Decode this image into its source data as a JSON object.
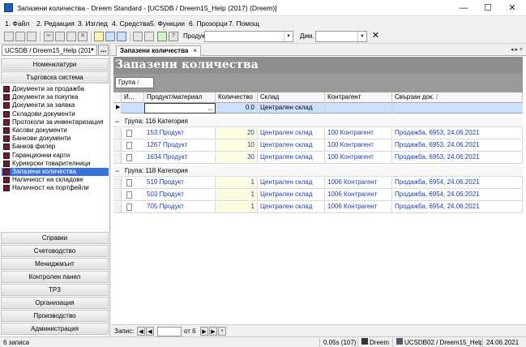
{
  "window": {
    "title": "Запазени количества - Dreem Standard - [UCSDB / Dreem15_Help (2017) (Dreem)]"
  },
  "menu": [
    "1. Файл",
    "2. Редакция",
    "3. Изглед",
    "4. Средства",
    "5. Функции",
    "6. Прозорци",
    "7. Помощ"
  ],
  "toolbar": {
    "product_label": "Продукт:",
    "dim_label": "Дим."
  },
  "sidebar": {
    "db": "UCSDB / Dreem15_Help (201",
    "top_sections": [
      "Номенклатури",
      "Търговска система"
    ],
    "items": [
      "Документи за продажба",
      "Документи за покупка",
      "Документи за заявка",
      "Складови документи",
      "Протоколи за инвентаризация",
      "Касови документи",
      "Банкови документи",
      "Банков филер",
      "Гаранционни карти",
      "Куриерски товарителници",
      "Запазени количества",
      "Наличност на складове",
      "Наличност на портфейли"
    ],
    "selected": "Запазени количества",
    "bottom_sections": [
      "Справки",
      "Счетоводство",
      "Мениджмънт",
      "Контролен панел",
      "ТРЗ",
      "Организация",
      "Производство",
      "Администрация"
    ]
  },
  "tab": {
    "label": "Запазени количества",
    "close": "×",
    "controls": "◂ ▸ ×"
  },
  "header": {
    "title": "Запазени количества"
  },
  "group_chip": "Група",
  "grid": {
    "columns": [
      "И...",
      "Продукт/материал",
      "Количество",
      "Склад",
      "Контрагент",
      "Свързан док."
    ],
    "new_row": {
      "qty": "0.0",
      "warehouse": "Централен склад"
    },
    "groups": [
      {
        "label": "Група: 116 Категория",
        "rows": [
          {
            "product": "153 Продукт",
            "qty": "20",
            "warehouse": "Централен склад",
            "partner": "100 Контрагент",
            "doc": "Продажба, 6953, 24.06.2021"
          },
          {
            "product": "1267 Продукт",
            "qty": "10",
            "warehouse": "Централен склад",
            "partner": "100 Контрагент",
            "doc": "Продажба, 6953, 24.06.2021"
          },
          {
            "product": "1634 Продукт",
            "qty": "30",
            "warehouse": "Централен склад",
            "partner": "100 Контрагент",
            "doc": "Продажба, 6953, 24.06.2021"
          }
        ]
      },
      {
        "label": "Група: 118 Категория",
        "rows": [
          {
            "product": "519 Продукт",
            "qty": "1",
            "warehouse": "Централен склад",
            "partner": "1006 Контрагент",
            "doc": "Продажба, 6954, 24.06.2021"
          },
          {
            "product": "503 Продукт",
            "qty": "1",
            "warehouse": "Централен склад",
            "partner": "1006 Контрагент",
            "doc": "Продажба, 6954, 24.06.2021"
          },
          {
            "product": "705 Продукт",
            "qty": "1",
            "warehouse": "Централен склад",
            "partner": "1006 Контрагент",
            "doc": "Продажба, 6954, 24.06.2021"
          }
        ]
      }
    ]
  },
  "navigator": {
    "label": "Запис:",
    "of": "от 6"
  },
  "status": {
    "records": "6 записа",
    "timing": "0.05s (107)",
    "user": "Dreem",
    "server": "UCSDB02 / Dreem15_Help",
    "date": "24.06.2021"
  }
}
